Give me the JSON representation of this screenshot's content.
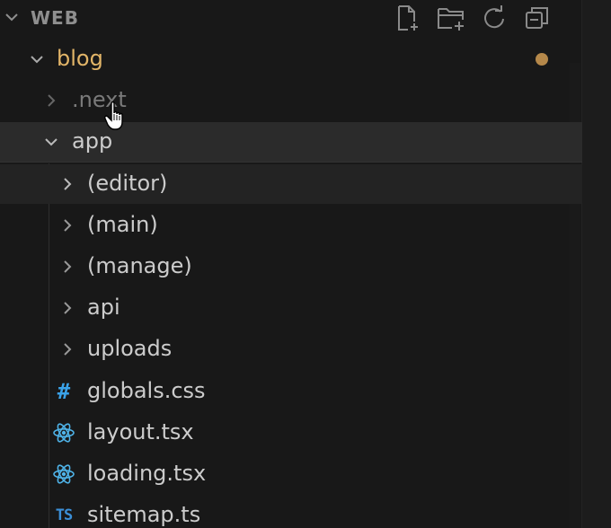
{
  "explorer": {
    "section_title": "WEB",
    "actions": [
      {
        "icon": "new-file-icon"
      },
      {
        "icon": "new-folder-icon"
      },
      {
        "icon": "refresh-icon"
      },
      {
        "icon": "collapse-all-icon"
      }
    ]
  },
  "tree": {
    "root": {
      "label": "blog",
      "modified": true
    },
    "next": {
      "label": ".next"
    },
    "app": {
      "label": "app"
    },
    "folders": [
      {
        "label": "(editor)"
      },
      {
        "label": "(main)"
      },
      {
        "label": "(manage)"
      },
      {
        "label": "api"
      },
      {
        "label": "uploads"
      }
    ],
    "files": [
      {
        "label": "globals.css",
        "icon": "css-hash-icon"
      },
      {
        "label": "layout.tsx",
        "icon": "react-icon"
      },
      {
        "label": "loading.tsx",
        "icon": "react-icon"
      },
      {
        "label": "sitemap.ts",
        "icon": "typescript-icon",
        "icon_text": "TS"
      }
    ]
  },
  "colors": {
    "background": "#181818",
    "folder_root": "#e2b568",
    "text": "#cccccc",
    "css_icon": "#3aa2e8",
    "react_icon": "#4fb3e8",
    "ts_icon": "#3b8fd8",
    "modified_dot": "#b5884a"
  }
}
